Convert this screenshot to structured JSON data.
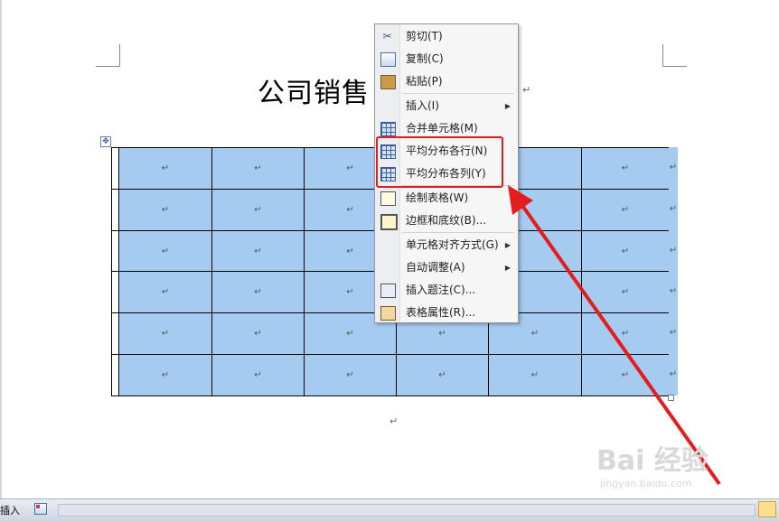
{
  "document": {
    "title": "公司销售",
    "title_tail_mark": "↵",
    "trailing_mark": "↵",
    "move_handle_glyph": "✥"
  },
  "table": {
    "rows": 6,
    "cell_mark": "↵",
    "cells": [
      [
        "↵",
        "↵",
        "↵",
        "",
        "",
        "↵",
        "↵"
      ],
      [
        "↵",
        "↵",
        "↵",
        "",
        "",
        "↵",
        "↵"
      ],
      [
        "↵",
        "↵",
        "↵",
        "",
        "",
        "↵",
        "↵"
      ],
      [
        "↵",
        "↵",
        "↵",
        "",
        "",
        "↵",
        "↵"
      ],
      [
        "↵",
        "↵",
        "↵",
        "↵",
        "↵",
        "↵",
        "↵"
      ],
      [
        "↵",
        "↵",
        "↵",
        "↵",
        "↵",
        "↵",
        "↵"
      ]
    ],
    "row_end_mark": "↵",
    "selection_color": "#a6cbf0"
  },
  "context_menu": {
    "items": [
      {
        "label": "剪切(T)",
        "icon": "scissors-icon",
        "submenu": false
      },
      {
        "label": "复制(C)",
        "icon": "copy-icon",
        "submenu": false
      },
      {
        "label": "粘贴(P)",
        "icon": "paste-icon",
        "submenu": false
      },
      {
        "label": "插入(I)",
        "icon": "",
        "submenu": true
      },
      {
        "label": "合并单元格(M)",
        "icon": "merge-cells-icon",
        "submenu": false
      },
      {
        "label": "平均分布各行(N)",
        "icon": "distribute-rows-icon",
        "submenu": false
      },
      {
        "label": "平均分布各列(Y)",
        "icon": "distribute-columns-icon",
        "submenu": false
      },
      {
        "label": "绘制表格(W)",
        "icon": "draw-table-icon",
        "submenu": false
      },
      {
        "label": "边框和底纹(B)...",
        "icon": "borders-shading-icon",
        "submenu": false
      },
      {
        "label": "单元格对齐方式(G)",
        "icon": "",
        "submenu": true
      },
      {
        "label": "自动调整(A)",
        "icon": "",
        "submenu": true
      },
      {
        "label": "插入题注(C)...",
        "icon": "insert-caption-icon",
        "submenu": false
      },
      {
        "label": "表格属性(R)...",
        "icon": "table-properties-icon",
        "submenu": false
      }
    ],
    "submenu_glyph": "▶",
    "scissors_glyph": "✂"
  },
  "annotation": {
    "highlight_color": "#e41c1c"
  },
  "watermark": {
    "main": "Bai 经验",
    "sub": "jingyan.baidu.com"
  },
  "statusbar": {
    "mode_text": "插入"
  }
}
